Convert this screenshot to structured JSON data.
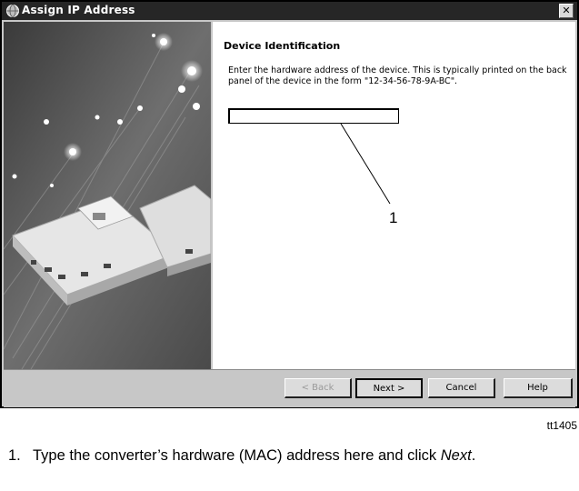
{
  "window": {
    "title": "Assign IP Address",
    "close_label": "✕"
  },
  "content": {
    "heading": "Device Identification",
    "instructions": "Enter the hardware address of the device.  This is typically printed on the back panel of the device in the form \"12-34-56-78-9A-BC\".",
    "mac_input_value": "",
    "mac_input_placeholder": ""
  },
  "callout": {
    "number": "1"
  },
  "buttons": {
    "back": "< Back",
    "next": "Next >",
    "cancel": "Cancel",
    "help": "Help"
  },
  "figure": {
    "id": "tt1405",
    "caption_number": "1.",
    "caption_text_before": "Type the converter’s hardware (MAC) address here and click ",
    "caption_emphasis": "Next",
    "caption_text_after": "."
  },
  "colors": {
    "titlebar": "#262626",
    "dialog_bg": "#c7c7c7",
    "pane_bg": "#ffffff"
  }
}
